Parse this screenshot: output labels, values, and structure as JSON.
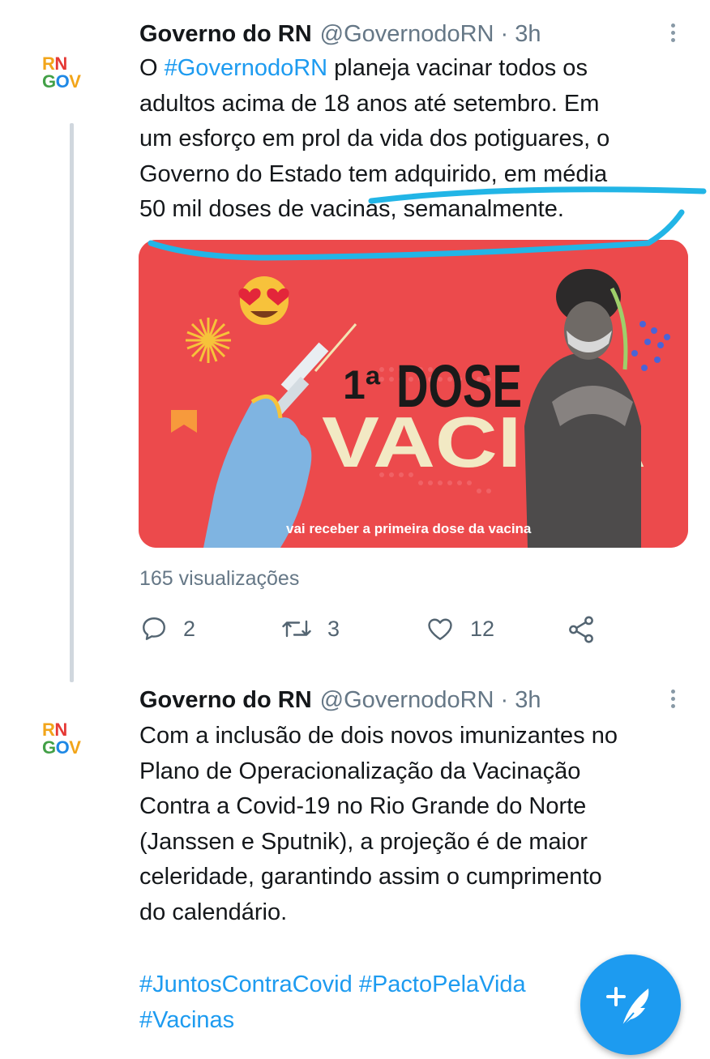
{
  "tweets": [
    {
      "avatar": {
        "line1": "RN",
        "line2": "GOV"
      },
      "name": "Governo do RN",
      "handle": "@GovernodoRN · 3h",
      "text_lines": [
        [
          "O ",
          "#GovernodoRN",
          " planeja vacinar todos os"
        ],
        "adultos acima de 18 anos até setembro. Em",
        "um esforço em prol da vida dos potiguares, o",
        "Governo do Estado tem adquirido, em média",
        "50 mil doses de vacinas, semanalmente."
      ],
      "media": {
        "headline_num": "1ª",
        "headline_word": "DOSE",
        "subtitle": "VACINA",
        "caption": "vai receber a primeira dose da vacina"
      },
      "views": "165 visualizações",
      "actions": {
        "replies": "2",
        "retweets": "3",
        "likes": "12"
      }
    },
    {
      "avatar": {
        "line1": "RN",
        "line2": "GOV"
      },
      "name": "Governo do RN",
      "handle": "@GovernodoRN · 3h",
      "text_lines": [
        "Com a inclusão de dois novos imunizantes no",
        "Plano de Operacionalização da Vacinação",
        "Contra a Covid-19 no Rio Grande do Norte",
        "(Janssen e Sputnik), a projeção é de maior",
        "celeridade, garantindo assim o cumprimento",
        "do calendário."
      ],
      "hashtags_line1": "#JuntosContraCovid #PactoPelaVida",
      "hashtags_line2": "#Vacinas"
    }
  ],
  "colors": {
    "accent": "#1d9bf0",
    "media_background": "#ec4a4c",
    "annotation_stroke": "#22b5e6"
  },
  "icons": [
    "more-vertical-icon",
    "reply-icon",
    "retweet-icon",
    "like-icon",
    "share-icon",
    "compose-tweet-icon"
  ]
}
